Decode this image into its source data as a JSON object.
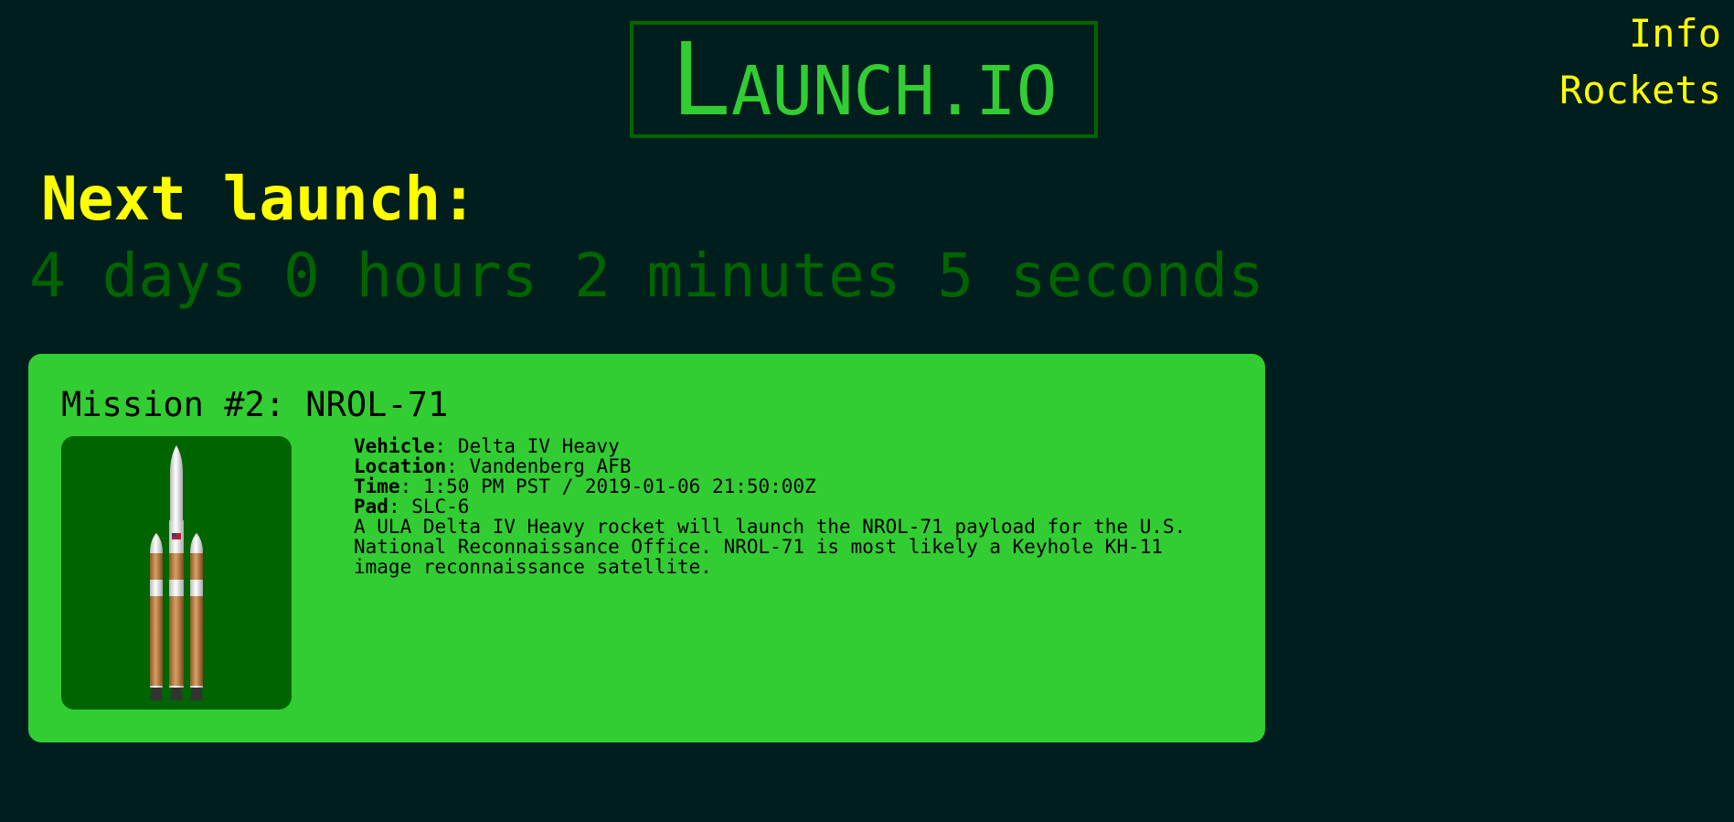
{
  "header": {
    "logo_first": "L",
    "logo_rest": "AUNCH.IO"
  },
  "nav": {
    "info": "Info",
    "rockets": "Rockets"
  },
  "next_launch": {
    "heading": "Next launch:",
    "countdown": "4 days 0 hours 2 minutes 5 seconds"
  },
  "mission": {
    "title": "Mission #2: NROL-71",
    "rocket_image_icon": "delta-iv-heavy-rocket-icon",
    "vehicle_label": "Vehicle",
    "vehicle": "Delta IV Heavy",
    "location_label": "Location",
    "location": "Vandenberg AFB",
    "time_label": "Time",
    "time": "1:50 PM PST / 2019-01-06 21:50:00Z",
    "pad_label": "Pad",
    "pad": "SLC-6",
    "description": "A ULA Delta IV Heavy rocket will launch the NROL-71 payload for the U.S.\nNational Reconnaissance Office. NROL-71 is most likely a Keyhole KH-11\nimage reconnaissance satellite."
  },
  "colors": {
    "background": "#001e1e",
    "accent_yellow": "#ffff00",
    "logo_green": "#32cd32",
    "dark_green": "#006400",
    "card_green": "#32cd32"
  }
}
